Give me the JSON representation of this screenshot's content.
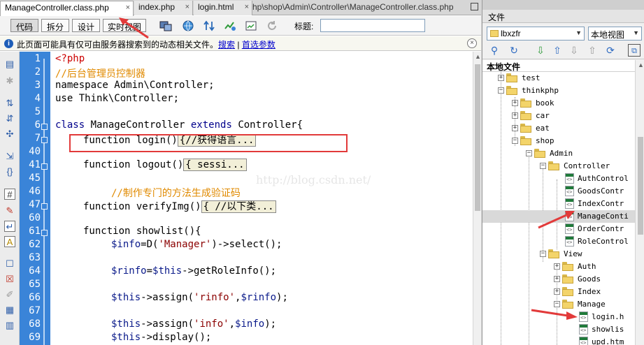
{
  "tabs": [
    {
      "label": "ManageController.class.php",
      "active": true
    },
    {
      "label": "index.php",
      "active": false
    },
    {
      "label": "login.html",
      "active": false
    }
  ],
  "tab_close": "×",
  "tab_path": "hp\\shop\\Admin\\Controller\\ManageController.class.php",
  "toolbar": {
    "code": "代码",
    "split": "拆分",
    "design": "设计",
    "live_view": "实时视图",
    "title_label": "标题:",
    "title_value": ""
  },
  "infobar": {
    "message": "此页面可能具有仅可由服务器搜索到的动态相关文件。",
    "search_link": "搜索",
    "separator": "|",
    "prefs_link": "首选参数",
    "close": "×"
  },
  "line_numbers": [
    "1",
    "2",
    "3",
    "4",
    "5",
    "6",
    "7",
    "40",
    "41",
    "45",
    "46",
    "47",
    "60",
    "61",
    "62",
    "63",
    "64",
    "65",
    "66",
    "67",
    "68",
    "69"
  ],
  "code_lines": {
    "l1": "<?php",
    "l2": "//后台管理员控制器",
    "l3": "namespace Admin\\Controller;",
    "l4": "use Think\\Controller;",
    "l6_class": "class",
    "l6_name": " ManageController ",
    "l6_extends": "extends",
    "l6_rest": " Controller{",
    "l7_fn": "function login()",
    "l7_fold": "{//获得语言...",
    "l41_fn": "function logout()",
    "l41_fold": "{ sessi...",
    "l46": "//制作专门的方法生成验证码",
    "l47_fn": "function verifyImg()",
    "l47_fold": "{ //以下类...",
    "l61": "function showlist(){",
    "l62_var": "$info",
    "l62_mid": "=D(",
    "l62_str": "'Manager'",
    "l62_end": ")->select();",
    "l64_var": "$rinfo",
    "l64_eq": "=",
    "l64_this": "$this",
    "l64_end": "->getRoleInfo();",
    "l66_this": "$this",
    "l66_mid": "->assign(",
    "l66_str": "'rinfo'",
    "l66_comma": ",",
    "l66_var": "$rinfo",
    "l66_end": ");",
    "l68_this": "$this",
    "l68_mid": "->assign(",
    "l68_str": "'info'",
    "l68_comma": ",",
    "l68_var": "$info",
    "l68_end": ");",
    "l69_this": "$this",
    "l69_end": "->display();"
  },
  "watermark": "http://blog.csdn.net/",
  "files_panel": {
    "title": "文件",
    "site": "lbxzfr",
    "view": "本地视图",
    "local_files": "本地文件"
  },
  "tree": [
    {
      "label": "test",
      "type": "folder"
    },
    {
      "label": "thinkphp",
      "type": "folder"
    },
    {
      "label": "book",
      "type": "folder"
    },
    {
      "label": "car",
      "type": "folder"
    },
    {
      "label": "eat",
      "type": "folder"
    },
    {
      "label": "shop",
      "type": "folder"
    },
    {
      "label": "Admin",
      "type": "folder"
    },
    {
      "label": "Controller",
      "type": "folder"
    },
    {
      "label": "AuthControl",
      "type": "file"
    },
    {
      "label": "GoodsContr",
      "type": "file"
    },
    {
      "label": "IndexContr",
      "type": "file"
    },
    {
      "label": "ManageConti",
      "type": "file",
      "selected": true
    },
    {
      "label": "OrderContr",
      "type": "file"
    },
    {
      "label": "RoleControl",
      "type": "file"
    },
    {
      "label": "View",
      "type": "folder"
    },
    {
      "label": "Auth",
      "type": "folder"
    },
    {
      "label": "Goods",
      "type": "folder"
    },
    {
      "label": "Index",
      "type": "folder"
    },
    {
      "label": "Manage",
      "type": "folder"
    },
    {
      "label": "login.h",
      "type": "file"
    },
    {
      "label": "showlis",
      "type": "file"
    },
    {
      "label": "upd.htm",
      "type": "file"
    }
  ],
  "colors": {
    "gutter": "#3a84d8",
    "highlight": "#e23a3a",
    "keyword": "#00008b",
    "comment": "#e08a00"
  }
}
